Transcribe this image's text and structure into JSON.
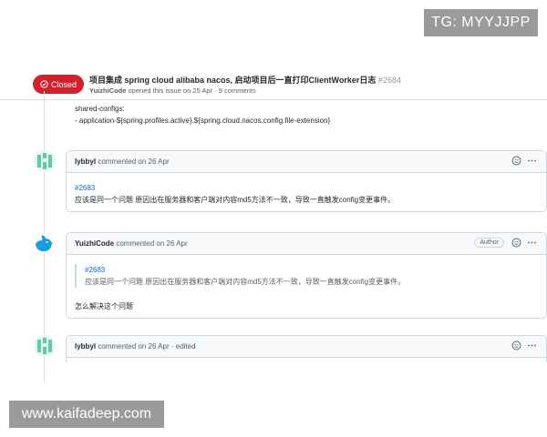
{
  "watermarks": {
    "top": "TG: MYYJJPP",
    "bottom": "www.kaifadeep.com"
  },
  "issue": {
    "state": "Closed",
    "title": "项目集成 spring cloud alibaba nacos, 启动项目后一直打印ClientWorker日志",
    "number": "#2684",
    "author": "YuizhiCode",
    "meta": "opened this issue on 25 Apr · 9 comments"
  },
  "previous_body": {
    "line1": "shared-configs:",
    "line2": "- application-${spring.profiles.active}.${spring.cloud.nacos.config.file-extension}"
  },
  "comments": [
    {
      "author": "lybbyl",
      "when": "commented on 26 Apr",
      "ref": "#2683",
      "text": "应该是同一个问题 原因出在服务器和客户端对内容md5方法不一致，导致一直触发config变更事件。"
    },
    {
      "author": "YuizhiCode",
      "when": "commented on 26 Apr",
      "badge": "Author",
      "quote_ref": "#2683",
      "quote_text": "应该是同一个问题 原因出在服务器和客户端对内容md5方法不一致，导致一直触发config变更事件。",
      "text": "怎么解决这个问题"
    },
    {
      "author": "lybbyl",
      "when": "commented on 26 Apr · edited"
    }
  ],
  "icons": {
    "badge": "closed-issue-icon",
    "reaction": "smiley-icon",
    "menu": "kebab-icon"
  }
}
